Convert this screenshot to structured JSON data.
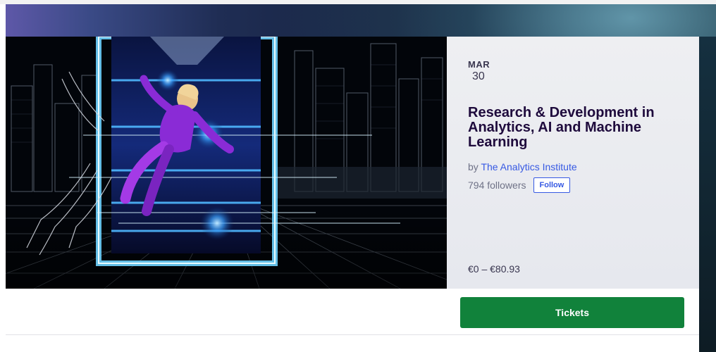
{
  "event": {
    "date": {
      "month": "MAR",
      "day": "30"
    },
    "title": "Research & Development in Analytics, AI and Machine Learning",
    "organizer": {
      "prefix": "by",
      "name": "The Analytics Institute"
    },
    "followers": "794 followers",
    "follow_label": "Follow",
    "price_range": "€0 – €80.93",
    "tickets_label": "Tickets",
    "image": {
      "icon": "event-banner-image"
    }
  },
  "colors": {
    "title": "#1e0a3c",
    "link": "#3659e3",
    "tickets_button": "#11823b"
  }
}
